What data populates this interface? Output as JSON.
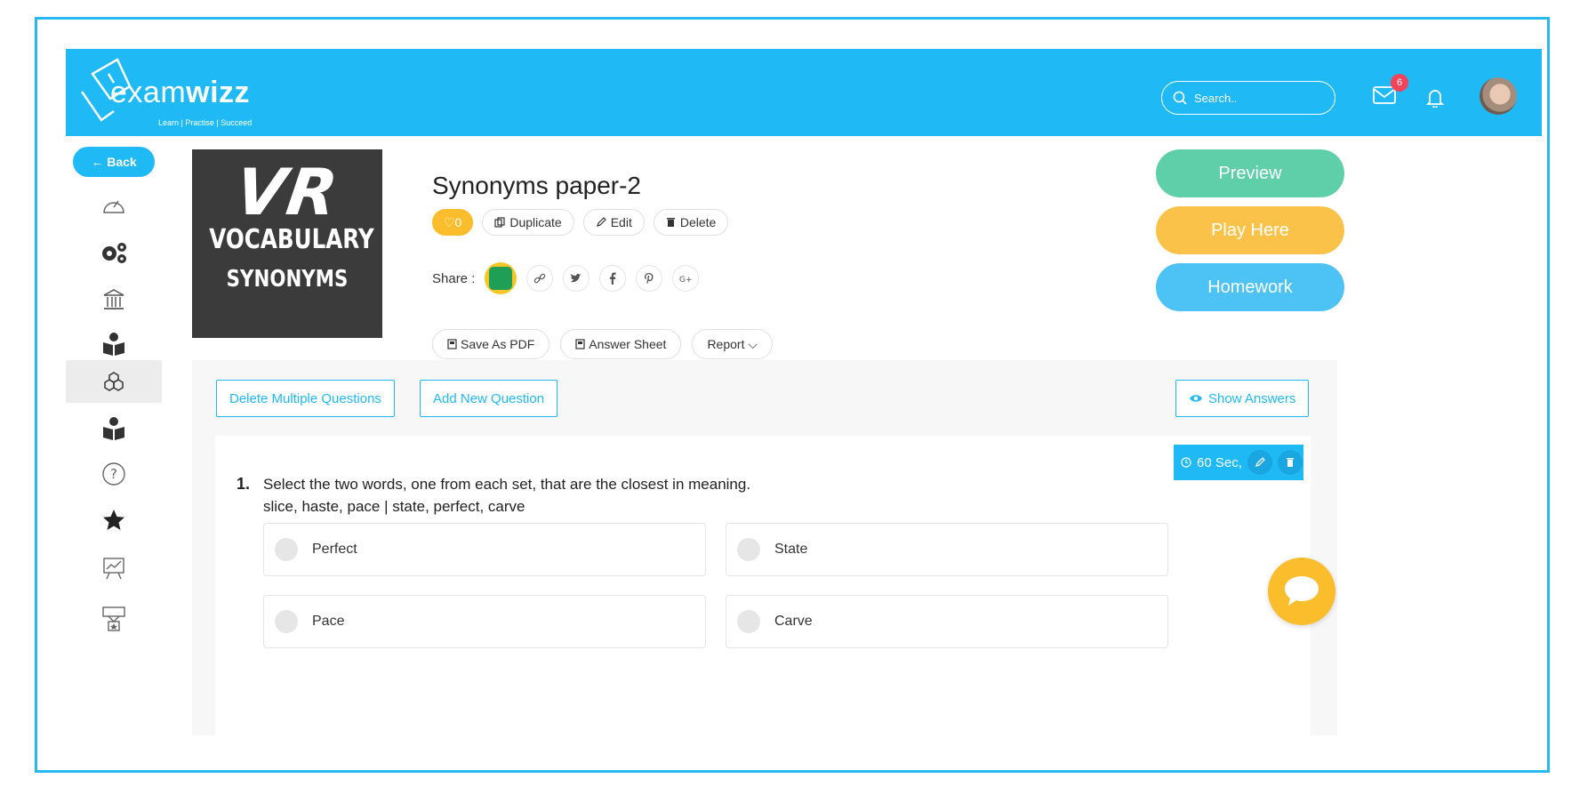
{
  "brand": {
    "name_light": "exam",
    "name_bold": "wizz",
    "tagline": "Learn | Practise | Succeed"
  },
  "header": {
    "search_placeholder": "Search..",
    "mail_count": "6"
  },
  "sidebar": {
    "back_label": "← Back",
    "items": [
      "dashboard-icon",
      "settings-icon",
      "institution-icon",
      "reader-icon",
      "cubes-icon",
      "reader-icon",
      "help-icon",
      "star-icon",
      "presentation-icon",
      "award-icon"
    ],
    "active_index": 4
  },
  "thumbnail": {
    "line1": "VR",
    "line2": "VOCABULARY",
    "line3": "SYNONYMS"
  },
  "paper": {
    "title": "Synonyms paper-2",
    "likes": "♡0",
    "duplicate": "Duplicate",
    "edit": "Edit",
    "delete": "Delete",
    "share_label": "Share :",
    "save_pdf": "Save As PDF",
    "answer_sheet": "Answer Sheet",
    "report": "Report ⌵"
  },
  "right_actions": {
    "preview": "Preview",
    "play": "Play Here",
    "homework": "Homework"
  },
  "colors": {
    "accent": "#1fbaf6",
    "preview": "#5ecfa9",
    "play": "#fbc24a",
    "homework": "#4cc3f4",
    "like": "#fbbd2c"
  },
  "questions_panel": {
    "delete_multiple": "Delete Multiple Questions",
    "add_new": "Add New Question",
    "show_answers": "Show Answers"
  },
  "question": {
    "number": "1.",
    "time": "60 Sec,",
    "text_line1": "Select the two words, one from each set, that are the closest in meaning.",
    "text_line2": "slice, haste, pace | state, perfect, carve",
    "options": [
      "Perfect",
      "State",
      "Pace",
      "Carve"
    ]
  }
}
